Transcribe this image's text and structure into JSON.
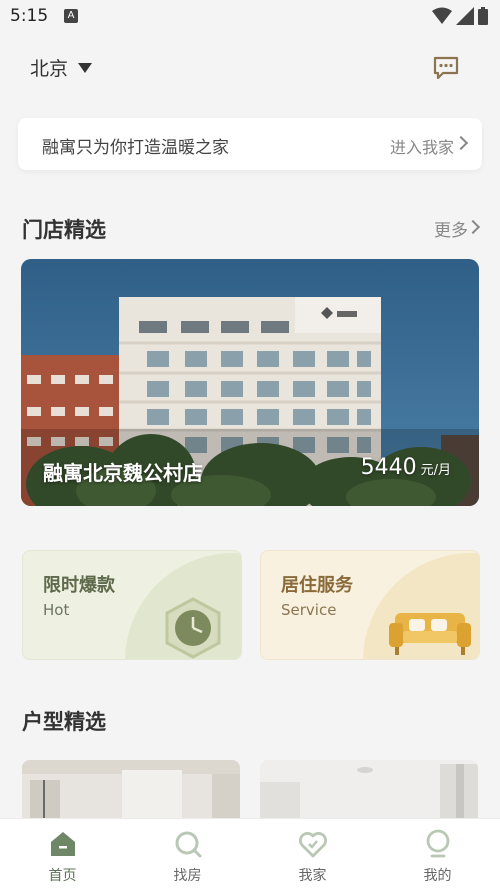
{
  "status": {
    "time": "5:15",
    "notification_icon": "A"
  },
  "header": {
    "city": "北京"
  },
  "notice": {
    "text": "融寓只为你打造温暖之家",
    "link": "进入我家"
  },
  "stores_section": {
    "title": "门店精选",
    "more": "更多"
  },
  "store": {
    "name": "融寓北京魏公村店",
    "price": "5440",
    "unit": "元/月"
  },
  "promos": [
    {
      "title": "限时爆款",
      "subtitle": "Hot"
    },
    {
      "title": "居住服务",
      "subtitle": "Service"
    }
  ],
  "rooms_section": {
    "title": "户型精选"
  },
  "tabs": [
    {
      "label": "首页",
      "icon": "home-icon",
      "active": true
    },
    {
      "label": "找房",
      "icon": "search-house-icon",
      "active": false
    },
    {
      "label": "我家",
      "icon": "heart-home-icon",
      "active": false
    },
    {
      "label": "我的",
      "icon": "profile-icon",
      "active": false
    }
  ],
  "colors": {
    "accent": "#5c7157",
    "background": "#f4f4f4"
  }
}
